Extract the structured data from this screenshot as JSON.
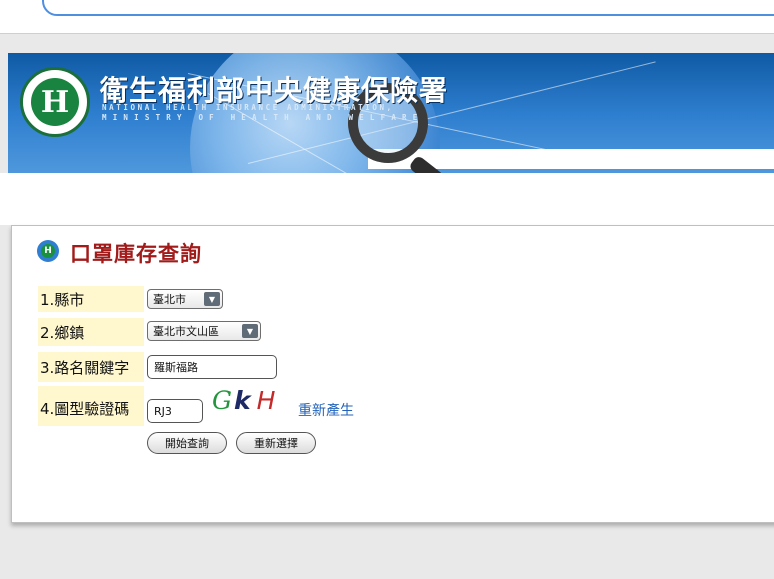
{
  "banner": {
    "org_name": "衛生福利部中央健康保險署",
    "org_name_en_line1": "NATIONAL HEALTH INSURANCE ADMINISTRATION,",
    "org_name_en_line2": "MINISTRY OF HEALTH AND WELFARE",
    "logo_letter": "H"
  },
  "page": {
    "title": "口罩庫存查詢",
    "title_icon_letter": "H"
  },
  "form": {
    "county": {
      "label": "1.縣市",
      "value": "臺北市"
    },
    "town": {
      "label": "2.鄉鎮",
      "value": "臺北市文山區"
    },
    "road": {
      "label": "3.路名關鍵字",
      "value": "羅斯福路"
    },
    "captcha": {
      "label": "4.圖型驗證碼",
      "value": "RJ3",
      "image_chars": [
        "G",
        "k",
        "H"
      ],
      "regenerate_label": "重新產生"
    },
    "buttons": {
      "search": "開始查詢",
      "reset": "重新選擇"
    }
  },
  "colors": {
    "title_red": "#a11b1b",
    "label_bg": "#fff8cf",
    "link_blue": "#2363b8",
    "banner_blue": "#2f7fd0"
  }
}
